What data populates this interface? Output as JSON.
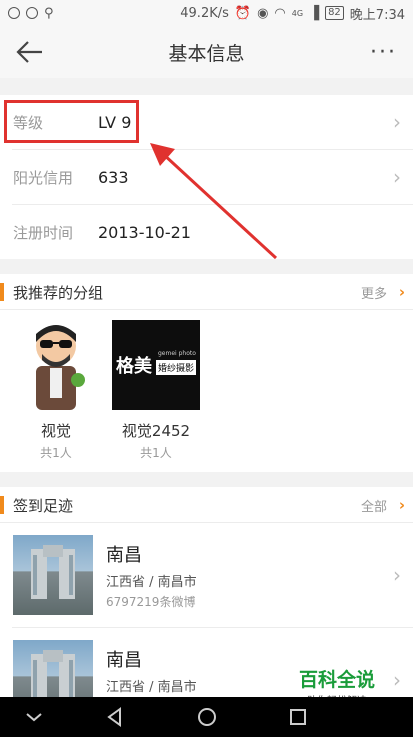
{
  "status_bar": {
    "speed": "49.2K/s",
    "battery": "82",
    "time": "晚上7:34",
    "network": "4G"
  },
  "nav": {
    "title": "基本信息",
    "more": "···"
  },
  "info": [
    {
      "label": "等级",
      "value": "LV 9"
    },
    {
      "label": "阳光信用",
      "value": "633"
    },
    {
      "label": "注册时间",
      "value": "2013-10-21"
    }
  ],
  "groups_section": {
    "title": "我推荐的分组",
    "more": "更多"
  },
  "groups": [
    {
      "name": "视觉",
      "count": "共1人"
    },
    {
      "name": "视觉2452",
      "count": "共1人",
      "logo_text": "格美",
      "logo_sub": "gemei photo",
      "logo_badge": "婚纱摄影"
    }
  ],
  "checkin_section": {
    "title": "签到足迹",
    "more": "全部"
  },
  "checkins": [
    {
      "title": "南昌",
      "location": "江西省 / 南昌市",
      "count": "6797219条微博"
    },
    {
      "title": "南昌",
      "location": "江西省 / 南昌市"
    }
  ],
  "watermark": {
    "title": "百科全说",
    "subtitle": "助你轻松解决"
  },
  "colors": {
    "accent": "#f08a1c",
    "highlight": "#e0322f"
  }
}
